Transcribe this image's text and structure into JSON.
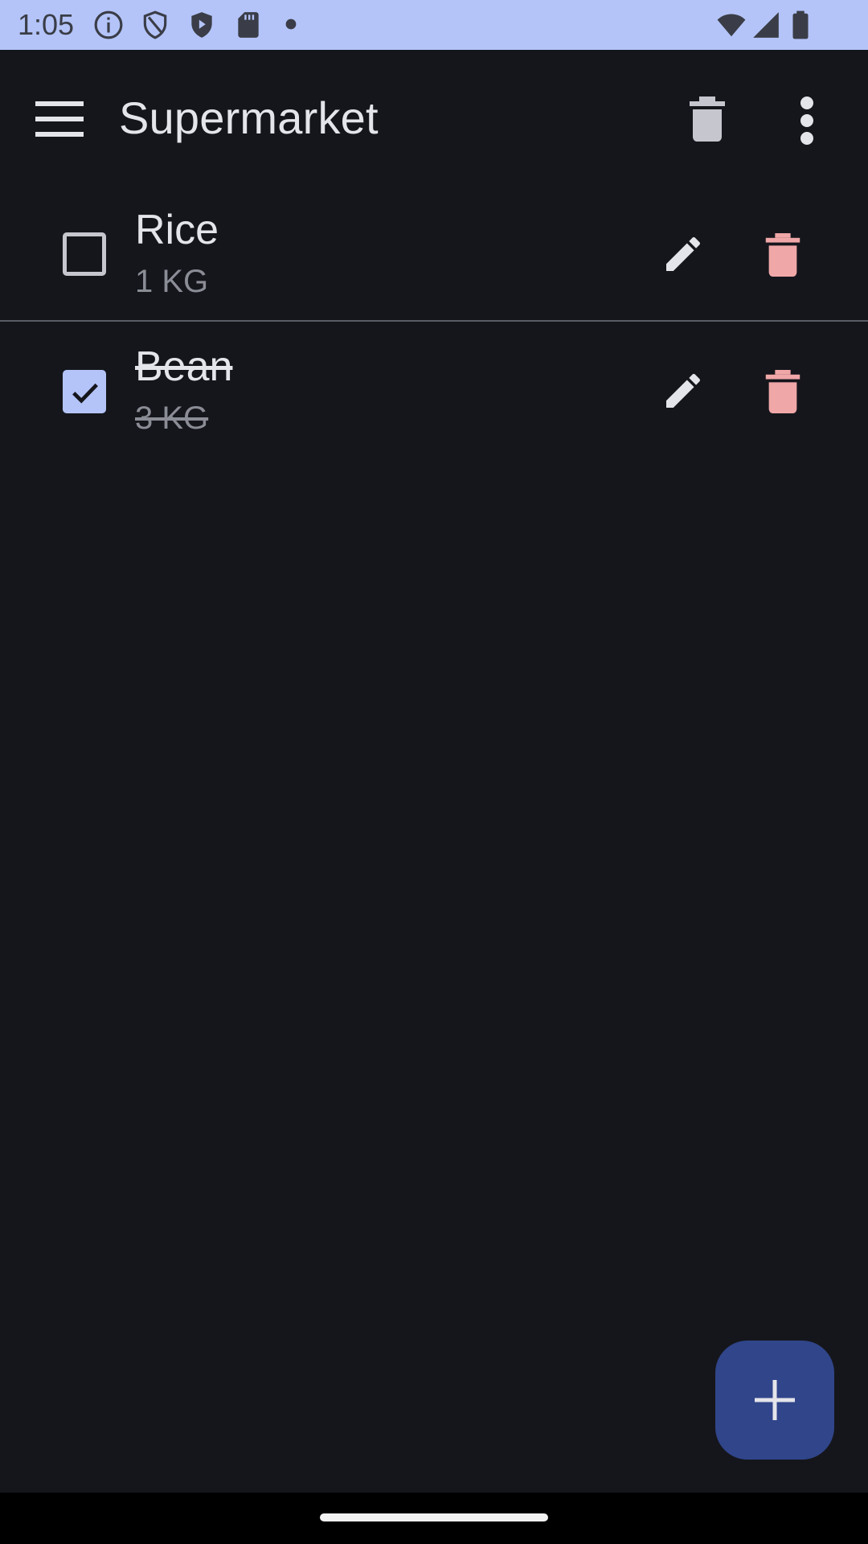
{
  "status_bar": {
    "time": "1:05",
    "icons": [
      "info-icon",
      "shield-icon",
      "play-shield-icon",
      "sd-card-icon",
      "dot-icon",
      "wifi-icon",
      "signal-icon",
      "battery-icon"
    ]
  },
  "app_bar": {
    "title": "Supermarket",
    "icons": [
      "menu-icon",
      "delete-all-icon",
      "more-vert-icon"
    ]
  },
  "items": [
    {
      "name": "Rice",
      "quantity": "1 KG",
      "checked": false
    },
    {
      "name": "Bean",
      "quantity": "3 KG",
      "checked": true
    }
  ],
  "fab": {
    "icon": "add-icon"
  },
  "colors": {
    "background": "#15161c",
    "status_bar": "#b4c4f8",
    "accent": "#b4c4f8",
    "fab": "#30458a",
    "delete": "#f0a7a7"
  }
}
